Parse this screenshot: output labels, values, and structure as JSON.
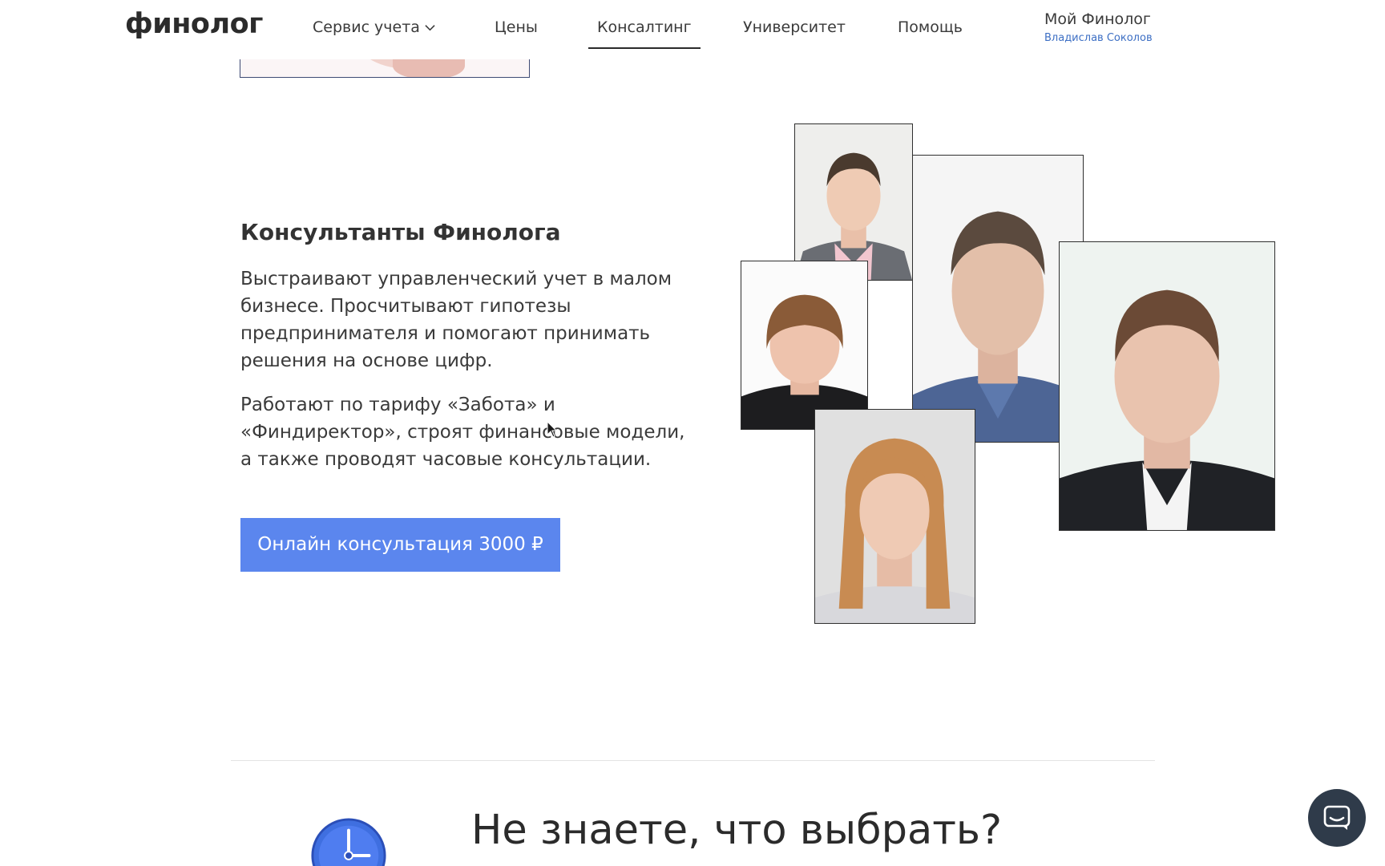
{
  "header": {
    "logo": "финолог",
    "nav": [
      {
        "label": "Сервис учета",
        "has_dropdown": true
      },
      {
        "label": "Цены"
      },
      {
        "label": "Консалтинг",
        "active": true
      },
      {
        "label": "Университет"
      },
      {
        "label": "Помощь"
      }
    ],
    "account": {
      "title": "Мой Финолог",
      "user": "Владислав Соколов"
    }
  },
  "consultants": {
    "title": "Консультанты Финолога",
    "paragraphs": [
      "Выстраивают управленческий учет в малом бизнесе. Просчитывают гипотезы предпринимателя и помогают принимать решения на основе цифр.",
      "Работают по тарифу «Забота» и «Финдиректор», строят финансовые модели, а также проводят часовые консультации."
    ],
    "cta_label": "Онлайн консультация 3000 ₽"
  },
  "bottom": {
    "heading": "Не знаете, что выбрать?"
  },
  "colors": {
    "accent": "#5b86ee",
    "link": "#3d6fc4",
    "chat": "#2f3b4a"
  },
  "icons": {
    "dropdown": "chevron-down-icon",
    "clock": "clock-icon",
    "chat": "chat-icon"
  }
}
